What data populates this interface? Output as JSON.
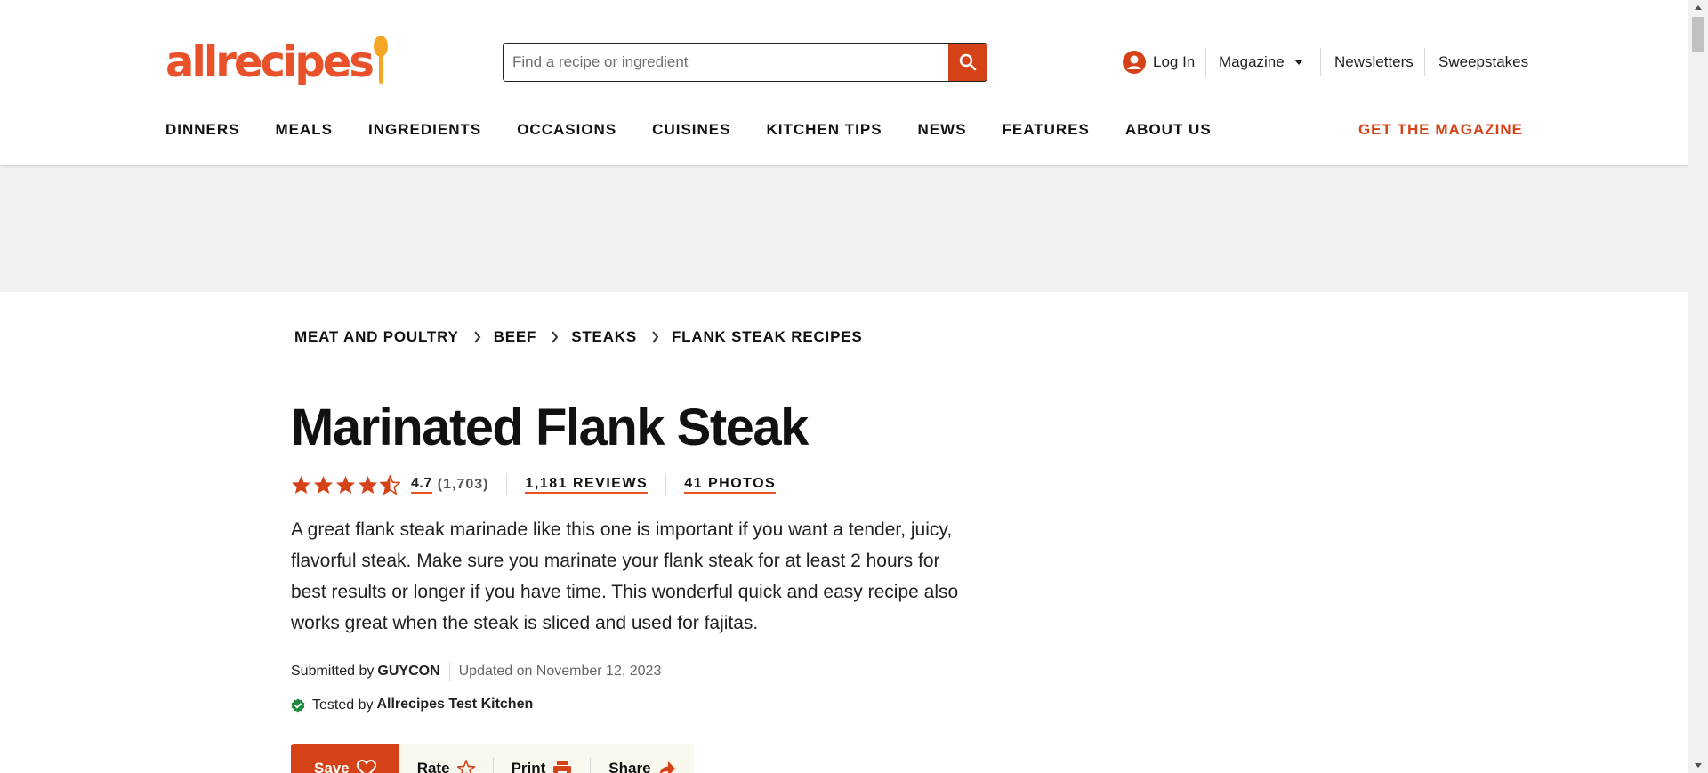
{
  "brand": {
    "logo_text": "allrecipes",
    "accent_color": "#d64217",
    "logo_color": "#e8512a",
    "spoon_color": "#f5a623"
  },
  "search": {
    "placeholder": "Find a recipe or ingredient",
    "value": "",
    "icon": "search-icon"
  },
  "utility_nav": {
    "login": "Log In",
    "magazine": "Magazine",
    "newsletters": "Newsletters",
    "sweepstakes": "Sweepstakes"
  },
  "main_nav": {
    "items": [
      "DINNERS",
      "MEALS",
      "INGREDIENTS",
      "OCCASIONS",
      "CUISINES",
      "KITCHEN TIPS",
      "NEWS",
      "FEATURES",
      "ABOUT US"
    ],
    "cta": "GET THE MAGAZINE"
  },
  "breadcrumb": [
    "MEAT AND POULTRY",
    "BEEF",
    "STEAKS",
    "FLANK STEAK RECIPES"
  ],
  "recipe": {
    "title": "Marinated Flank Steak",
    "rating_value": "4.7",
    "rating_count": "(1,703)",
    "stars_filled": 4.5,
    "stars_total": 5,
    "reviews": "1,181 REVIEWS",
    "photos": "41 PHOTOS",
    "description": "A great flank steak marinade like this one is important if you want a tender, juicy, flavorful steak. Make sure you marinate your flank steak for at least 2 hours for best results or longer if you have time. This wonderful quick and easy recipe also works great when the steak is sliced and used for fajitas.",
    "submitted_label": "Submitted by",
    "submitted_by": "GUYCON",
    "updated": "Updated on November 12, 2023",
    "tested_label": "Tested by",
    "tested_by": "Allrecipes Test Kitchen"
  },
  "actions": {
    "save": "Save",
    "rate": "Rate",
    "print": "Print",
    "share": "Share"
  }
}
